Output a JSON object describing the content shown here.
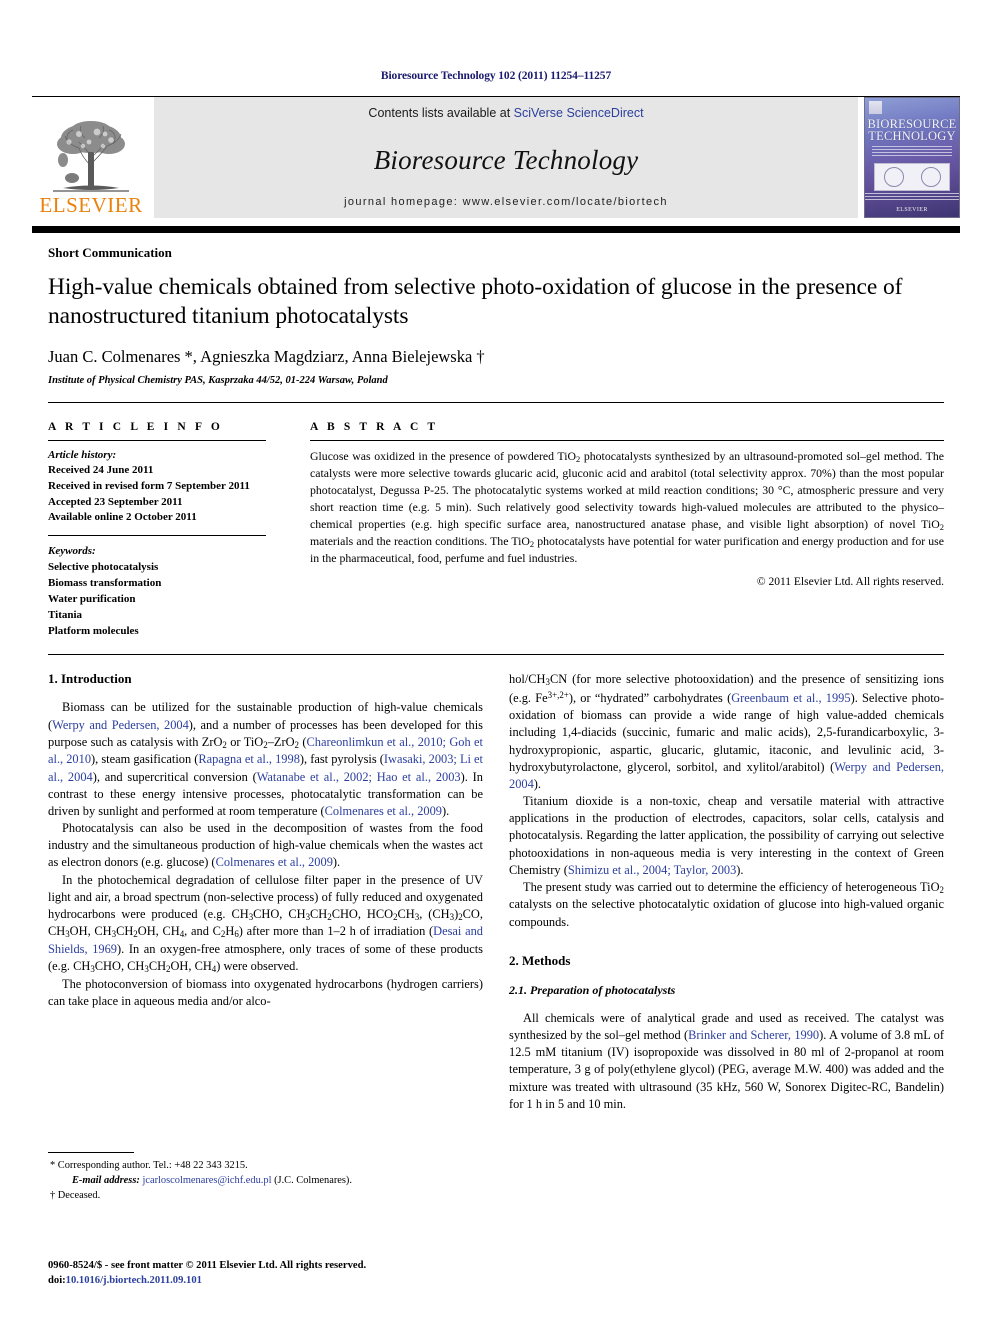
{
  "running_head": "Bioresource Technology 102 (2011) 11254–11257",
  "journal_header": {
    "contents_prefix": "Contents lists available at ",
    "sciencedirect_link": "SciVerse ScienceDirect",
    "journal_name": "Bioresource Technology",
    "homepage": "journal homepage: www.elsevier.com/locate/biortech",
    "publisher_logo_text": "ELSEVIER",
    "cover_title_line1": "BIORESOURCE",
    "cover_title_line2": "TECHNOLOGY",
    "cover_footer_logo": "ELSEVIER"
  },
  "article": {
    "type": "Short Communication",
    "title": "High-value chemicals obtained from selective photo-oxidation of glucose in the presence of nanostructured titanium photocatalysts",
    "authors": "Juan C. Colmenares *, Agnieszka Magdziarz, Anna Bielejewska †",
    "affiliation": "Institute of Physical Chemistry PAS, Kasprzaka 44/52, 01-224 Warsaw, Poland"
  },
  "article_info": {
    "heading": "A R T I C L E   I N F O",
    "history_label": "Article history:",
    "history": [
      "Received 24 June 2011",
      "Received in revised form 7 September 2011",
      "Accepted 23 September 2011",
      "Available online 2 October 2011"
    ],
    "keywords_label": "Keywords:",
    "keywords": [
      "Selective photocatalysis",
      "Biomass transformation",
      "Water purification",
      "Titania",
      "Platform molecules"
    ]
  },
  "abstract": {
    "heading": "A B S T R A C T",
    "text": "Glucose was oxidized in the presence of powdered TiO2 photocatalysts synthesized by an ultrasound-promoted sol–gel method. The catalysts were more selective towards glucaric acid, gluconic acid and arabitol (total selectivity approx. 70%) than the most popular photocatalyst, Degussa P-25. The photocatalytic systems worked at mild reaction conditions; 30 °C, atmospheric pressure and very short reaction time (e.g. 5 min). Such relatively good selectivity towards high-valued molecules are attributed to the physico–chemical properties (e.g. high specific surface area, nanostructured anatase phase, and visible light absorption) of novel TiO2 materials and the reaction conditions. The TiO2 photocatalysts have potential for water purification and energy production and for use in the pharmaceutical, food, perfume and fuel industries.",
    "copyright": "© 2011 Elsevier Ltd. All rights reserved."
  },
  "sections": {
    "intro_heading": "1. Introduction",
    "intro_p1": "Biomass can be utilized for the sustainable production of high-value chemicals (Werpy and Pedersen, 2004), and a number of processes has been developed for this purpose such as catalysis with ZrO2 or TiO2–ZrO2 (Chareonlimkun et al., 2010; Goh et al., 2010), steam gasification (Rapagna et al., 1998), fast pyrolysis (Iwasaki, 2003; Li et al., 2004), and supercritical conversion (Watanabe et al., 2002; Hao et al., 2003). In contrast to these energy intensive processes, photocatalytic transformation can be driven by sunlight and performed at room temperature (Colmenares et al., 2009).",
    "intro_p2": "Photocatalysis can also be used in the decomposition of wastes from the food industry and the simultaneous production of high-value chemicals when the wastes act as electron donors (e.g. glucose) (Colmenares et al., 2009).",
    "intro_p3": "In the photochemical degradation of cellulose filter paper in the presence of UV light and air, a broad spectrum (non-selective process) of fully reduced and oxygenated hydrocarbons were produced (e.g. CH3CHO, CH3CH2CHO, HCO2CH3, (CH3)2CO, CH3OH, CH3CH2OH, CH4, and C2H6) after more than 1–2 h of irradiation (Desai and Shields, 1969). In an oxygen-free atmosphere, only traces of some of these products (e.g. CH3CHO, CH3CH2OH, CH4) were observed.",
    "intro_p4": "The photoconversion of biomass into oxygenated hydrocarbons (hydrogen carriers) can take place in aqueous media and/or alcohol/CH3CN (for more selective photooxidation) and the presence of sensitizing ions (e.g. Fe3+,2+), or “hydrated” carbohydrates (Greenbaum et al., 1995). Selective photo-oxidation of biomass can provide a wide range of high value-added chemicals including 1,4-diacids (succinic, fumaric and malic acids), 2,5-furandicarboxylic, 3-hydroxypropionic, aspartic, glucaric, glutamic, itaconic, and levulinic acid, 3-hydroxybutyrolactone, glycerol, sorbitol, and xylitol/arabitol) (Werpy and Pedersen, 2004).",
    "intro_p5": "Titanium dioxide is a non-toxic, cheap and versatile material with attractive applications in the production of electrodes, capacitors, solar cells, catalysis and photocatalysis. Regarding the latter application, the possibility of carrying out selective photooxidations in non-aqueous media is very interesting in the context of Green Chemistry (Shimizu et al., 2004; Taylor, 2003).",
    "intro_p6": "The present study was carried out to determine the efficiency of heterogeneous TiO2 catalysts on the selective photocatalytic oxidation of glucose into high-valued organic compounds.",
    "methods_heading": "2. Methods",
    "methods_sub_heading": "2.1. Preparation of photocatalysts",
    "methods_p1": "All chemicals were of analytical grade and used as received. The catalyst was synthesized by the sol–gel method (Brinker and Scherer, 1990). A volume of 3.8 mL of 12.5 mM titanium (IV) isopropoxide was dissolved in 80 ml of 2-propanol at room temperature, 3 g of poly(ethylene glycol) (PEG, average M.W. 400) was added and the mixture was treated with ultrasound (35 kHz, 560 W, Sonorex Digitec-RC, Bandelin) for 1 h in 5 and 10 min."
  },
  "footnotes": {
    "corresponding": "* Corresponding author. Tel.: +48 22 343 3215.",
    "email_label": "E-mail address:",
    "email": "jcarloscolmenares@ichf.edu.pl",
    "email_suffix": "(J.C. Colmenares).",
    "deceased": "† Deceased."
  },
  "imprint": {
    "line1": "0960-8524/$ - see front matter © 2011 Elsevier Ltd. All rights reserved.",
    "doi_label": "doi:",
    "doi": "10.1016/j.biortech.2011.09.101"
  },
  "colors": {
    "link": "#2b3f9e",
    "elsevier_orange": "#E8820C",
    "header_band": "#e6e6e6",
    "running_head": "#1a1a6e"
  }
}
